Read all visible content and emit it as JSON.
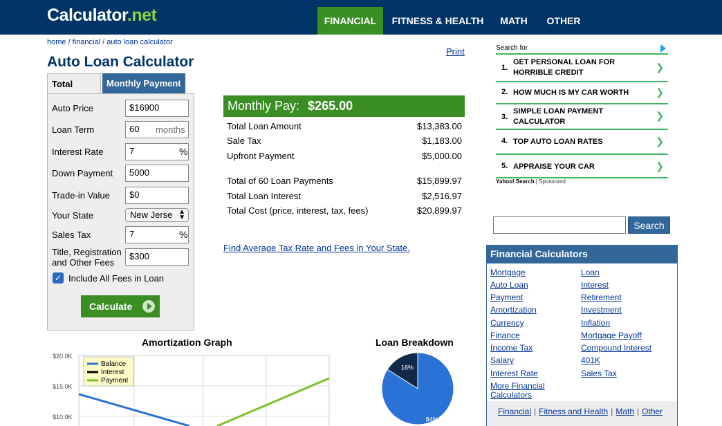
{
  "header": {
    "logo_main": "Calculator",
    "logo_suffix": ".net",
    "nav": [
      "FINANCIAL",
      "FITNESS & HEALTH",
      "MATH",
      "OTHER"
    ]
  },
  "breadcrumb": "home / financial / auto loan calculator",
  "print_label": "Print",
  "title": "Auto Loan Calculator",
  "tabs": [
    "Total Price",
    "Monthly Payment"
  ],
  "form": {
    "auto_price_label": "Auto Price",
    "auto_price_value": "$16900",
    "loan_term_label": "Loan Term",
    "loan_term_value": "60",
    "loan_term_suffix": "months",
    "interest_rate_label": "Interest Rate",
    "interest_rate_value": "7",
    "percent": "%",
    "down_payment_label": "Down Payment",
    "down_payment_value": "5000",
    "trade_in_label": "Trade-in Value",
    "trade_in_value": "$0",
    "state_label": "Your State",
    "state_value": "New Jerse",
    "sales_tax_label": "Sales Tax",
    "sales_tax_value": "7",
    "fees_label_1": "Title, Registration",
    "fees_label_2": "and Other Fees",
    "fees_value": "$300",
    "include_fees_label": "Include All Fees in Loan",
    "calculate_label": "Calculate"
  },
  "results": {
    "monthly_label": "Monthly Pay:",
    "monthly_value": "$265.00",
    "rows": [
      {
        "label": "Total Loan Amount",
        "value": "$13,383.00"
      },
      {
        "label": "Sale Tax",
        "value": "$1,183.00"
      },
      {
        "label": "Upfront Payment",
        "value": "$5,000.00"
      },
      {
        "label": "Total of 60 Loan Payments",
        "value": "$15,899.97"
      },
      {
        "label": "Total Loan Interest",
        "value": "$2,516.97"
      },
      {
        "label": "Total Cost (price, interest, tax, fees)",
        "value": "$20,899.97"
      }
    ],
    "find_link": "Find Average Tax Rate and Fees in Your State."
  },
  "amortization": {
    "title": "Amortization Graph",
    "y_ticks": [
      "$20.0K",
      "$15.0K",
      "$10.0K"
    ],
    "legend": [
      "Balance",
      "Interest",
      "Payment"
    ],
    "colors": {
      "balance": "#2a72d6",
      "interest": "#000000",
      "payment": "#7cc22a"
    }
  },
  "breakdown": {
    "title": "Loan Breakdown",
    "slices": [
      {
        "label": "16%",
        "value": 16,
        "color": "#102a47"
      },
      {
        "label": "84%",
        "value": 84,
        "color": "#2a72d6"
      }
    ]
  },
  "sponsored": {
    "search_for": "Search for",
    "items": [
      {
        "num": "1.",
        "text": "GET PERSONAL LOAN FOR HORRIBLE CREDIT"
      },
      {
        "num": "2.",
        "text": "HOW MUCH IS MY CAR WORTH"
      },
      {
        "num": "3.",
        "text": "SIMPLE LOAN PAYMENT CALCULATOR"
      },
      {
        "num": "4.",
        "text": "TOP AUTO LOAN RATES"
      },
      {
        "num": "5.",
        "text": "APPRAISE YOUR CAR"
      }
    ],
    "yahoo": "Yahoo! Search",
    "sponsored": "Sponsored"
  },
  "search_button": "Search",
  "financial_calcs": {
    "title": "Financial Calculators",
    "left": [
      "Mortgage",
      "Auto Loan",
      "Payment",
      "Amortization",
      "Currency",
      "Finance",
      "Income Tax",
      "Salary",
      "Interest Rate",
      "More Financial Calculators"
    ],
    "right": [
      "Loan",
      "Interest",
      "Retirement",
      "Investment",
      "Inflation",
      "Mortgage Payoff",
      "Compound Interest",
      "401K",
      "Sales Tax"
    ],
    "footer": [
      "Financial",
      "Fitness and Health",
      "Math",
      "Other"
    ]
  }
}
